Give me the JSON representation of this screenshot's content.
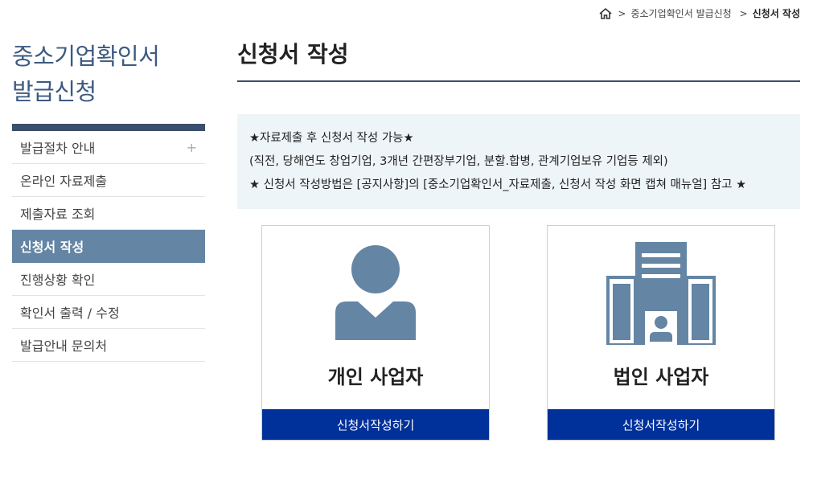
{
  "breadcrumb": {
    "home_icon": "home-icon",
    "items": [
      "중소기업확인서 발급신청",
      "신청서 작성"
    ]
  },
  "sidebar": {
    "title_line1": "중소기업확인서",
    "title_line2": "발급신청",
    "items": [
      {
        "label": "발급절차 안내",
        "plus": "+"
      },
      {
        "label": "온라인 자료제출"
      },
      {
        "label": "제출자료 조회"
      },
      {
        "label": "신청서 작성"
      },
      {
        "label": "진행상황 확인"
      },
      {
        "label": "확인서 출력 / 수정"
      },
      {
        "label": "발급안내 문의처"
      }
    ]
  },
  "main": {
    "title": "신청서 작성",
    "notice": {
      "line1": "★자료제출 후 신청서 작성 가능★",
      "line2": "(직전, 당해연도 창업기업, 3개년 간편장부기업, 분할.합병, 관계기업보유 기업등 제외)",
      "line3": "★ 신청서 작성방법은 [공지사항]의 [중소기업확인서_자료제출, 신청서 작성 화면 캡쳐 매뉴얼] 참고 ★"
    },
    "cards": [
      {
        "icon": "person-icon",
        "label": "개인 사업자",
        "button": "신청서작성하기"
      },
      {
        "icon": "building-icon",
        "label": "법인 사업자",
        "button": "신청서작성하기"
      }
    ]
  },
  "colors": {
    "accent": "#3a4f6b",
    "active_menu": "#6485a4",
    "icon": "#6485a4",
    "button": "#00309a",
    "notice_bg": "#eef5f9"
  }
}
